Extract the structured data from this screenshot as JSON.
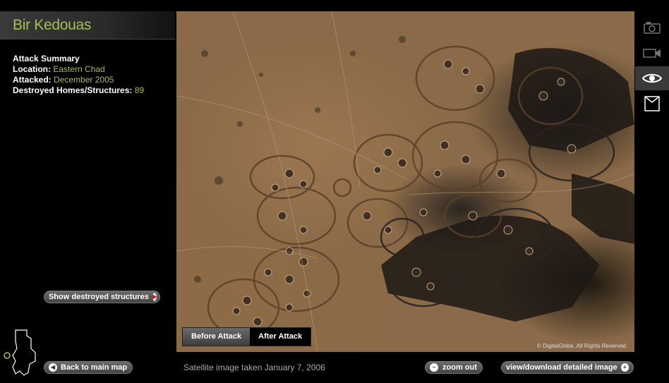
{
  "header": {
    "title": "Bir Kedouas"
  },
  "summary": {
    "heading": "Attack Summary",
    "location_label": "Location:",
    "location_value": "Eastern Chad",
    "attacked_label": "Attacked:",
    "attacked_value": "December 2005",
    "destroyed_label": "Destroyed Homes/Structures:",
    "destroyed_value": "89"
  },
  "buttons": {
    "show_destroyed": "Show destroyed structures",
    "back_to_map": "Back to main map",
    "zoom_out": "zoom out",
    "view_download": "view/download detailed image"
  },
  "toggle": {
    "before": "Before Attack",
    "after": "After Attack",
    "selected": "After Attack"
  },
  "image": {
    "caption": "Satellite image taken January 7, 2006",
    "copyright": "© DigitalGlobe, All Rights Reserved"
  },
  "toolbar": {
    "items": [
      {
        "icon": "camera-icon",
        "active": false
      },
      {
        "icon": "video-camera-icon",
        "active": false
      },
      {
        "icon": "eye-icon",
        "active": true
      },
      {
        "icon": "info-card-icon",
        "active": false
      }
    ]
  },
  "colors": {
    "accent": "#a3bf55",
    "background": "#000000",
    "button": "#555555",
    "arrow_red": "#c02020"
  }
}
